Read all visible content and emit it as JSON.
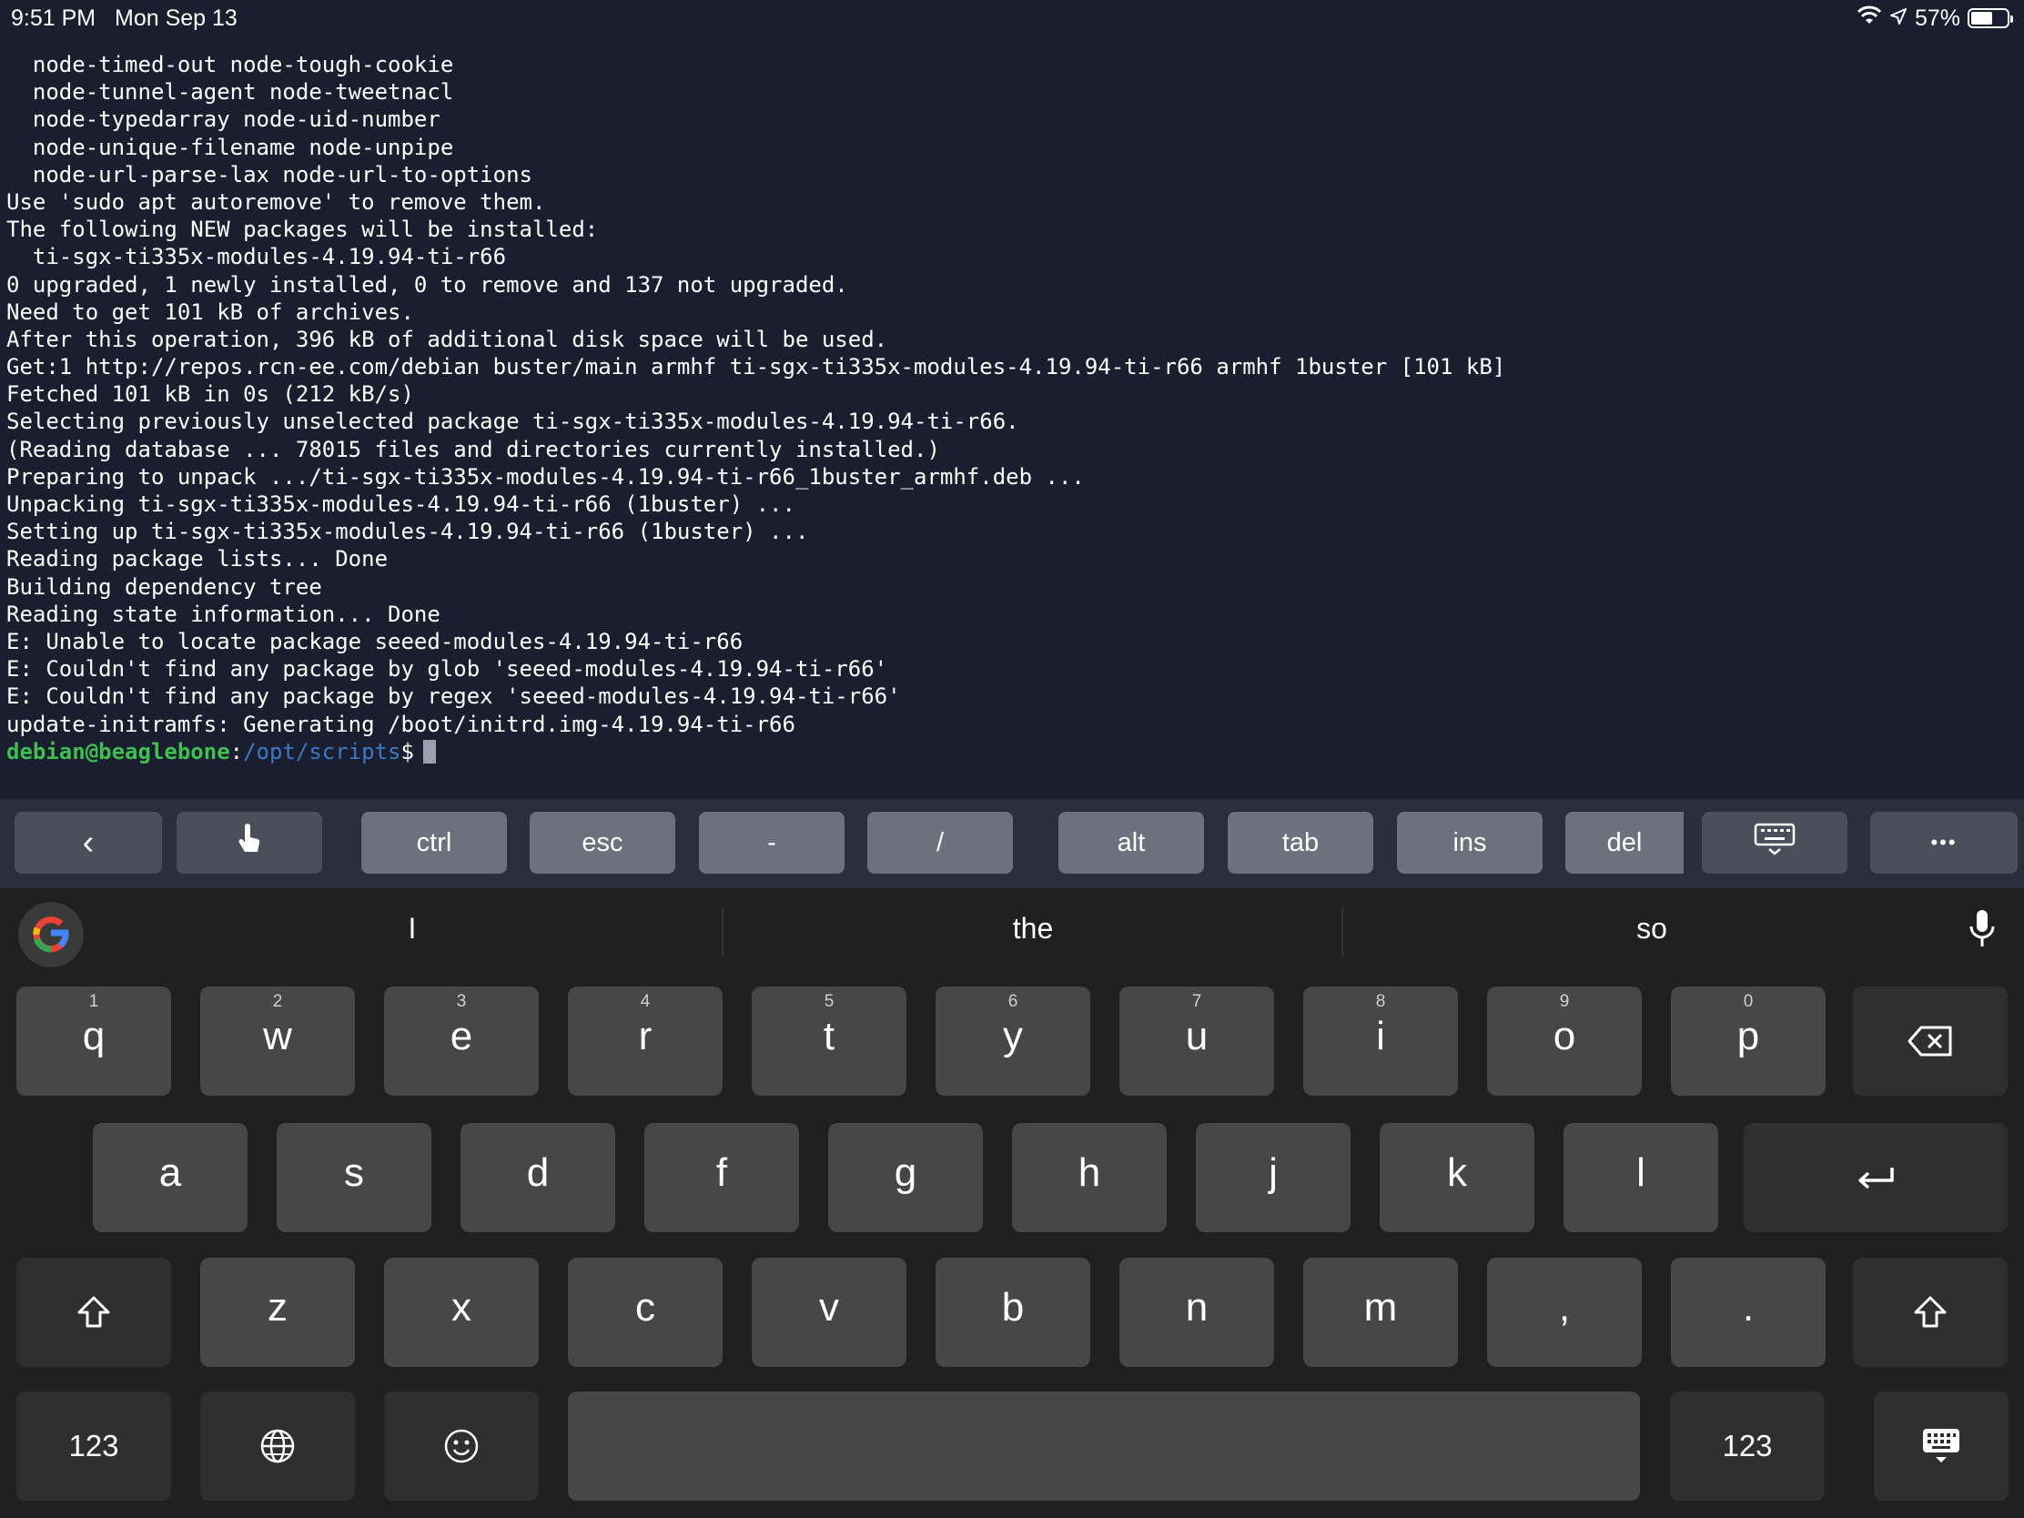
{
  "status_bar": {
    "time": "9:51 PM",
    "date": "Mon Sep 13",
    "battery": "57%",
    "battery_level": 0.57,
    "icons": [
      "wifi-icon",
      "location-arrow-icon",
      "battery-icon"
    ]
  },
  "terminal": {
    "lines": [
      "  node-timed-out node-tough-cookie",
      "  node-tunnel-agent node-tweetnacl",
      "  node-typedarray node-uid-number",
      "  node-unique-filename node-unpipe",
      "  node-url-parse-lax node-url-to-options",
      "Use 'sudo apt autoremove' to remove them.",
      "The following NEW packages will be installed:",
      "  ti-sgx-ti335x-modules-4.19.94-ti-r66",
      "0 upgraded, 1 newly installed, 0 to remove and 137 not upgraded.",
      "Need to get 101 kB of archives.",
      "After this operation, 396 kB of additional disk space will be used.",
      "Get:1 http://repos.rcn-ee.com/debian buster/main armhf ti-sgx-ti335x-modules-4.19.94-ti-r66 armhf 1buster [101 kB]",
      "Fetched 101 kB in 0s (212 kB/s)",
      "Selecting previously unselected package ti-sgx-ti335x-modules-4.19.94-ti-r66.",
      "(Reading database ... 78015 files and directories currently installed.)",
      "Preparing to unpack .../ti-sgx-ti335x-modules-4.19.94-ti-r66_1buster_armhf.deb ...",
      "Unpacking ti-sgx-ti335x-modules-4.19.94-ti-r66 (1buster) ...",
      "Setting up ti-sgx-ti335x-modules-4.19.94-ti-r66 (1buster) ...",
      "Reading package lists... Done",
      "Building dependency tree",
      "Reading state information... Done",
      "E: Unable to locate package seeed-modules-4.19.94-ti-r66",
      "E: Couldn't find any package by glob 'seeed-modules-4.19.94-ti-r66'",
      "E: Couldn't find any package by regex 'seeed-modules-4.19.94-ti-r66'",
      "update-initramfs: Generating /boot/initrd.img-4.19.94-ti-r66"
    ],
    "prompt": {
      "user_host": "debian@beaglebone",
      "separator": ":",
      "path": "/opt/scripts",
      "symbol": "$"
    },
    "colors": {
      "background": "#1a1e2e",
      "prompt_user": "#3fbf4f",
      "prompt_path": "#3c78c8"
    }
  },
  "accessory_bar": {
    "back": "‹",
    "ctrl": "ctrl",
    "esc": "esc",
    "dash": "-",
    "slash": "/",
    "alt": "alt",
    "tab": "tab",
    "ins": "ins",
    "del": "del",
    "more": "•••"
  },
  "keyboard": {
    "suggestions": [
      "I",
      "the",
      "so"
    ],
    "row1": [
      {
        "num": "1",
        "key": "q"
      },
      {
        "num": "2",
        "key": "w"
      },
      {
        "num": "3",
        "key": "e"
      },
      {
        "num": "4",
        "key": "r"
      },
      {
        "num": "5",
        "key": "t"
      },
      {
        "num": "6",
        "key": "y"
      },
      {
        "num": "7",
        "key": "u"
      },
      {
        "num": "8",
        "key": "i"
      },
      {
        "num": "9",
        "key": "o"
      },
      {
        "num": "0",
        "key": "p"
      }
    ],
    "row2": [
      "a",
      "s",
      "d",
      "f",
      "g",
      "h",
      "j",
      "k",
      "l"
    ],
    "row3": [
      "z",
      "x",
      "c",
      "v",
      "b",
      "n",
      "m",
      ",",
      "."
    ],
    "numbers_left": "123",
    "numbers_right": "123"
  }
}
